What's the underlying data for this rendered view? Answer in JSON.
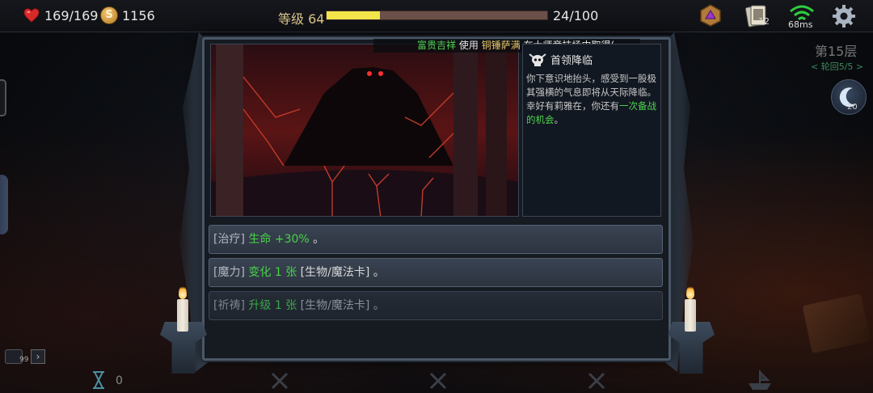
{
  "status": {
    "hp": "169/169",
    "gold": "1156",
    "gold_icon_letter": "S",
    "level_label": "等级 64",
    "xp_progress": 0.24,
    "xp_text": "24/100",
    "deck_count": "12",
    "ping": "68ms"
  },
  "floor": {
    "label": "第15层",
    "round": "< 轮回5/5 >",
    "moon_count": "20"
  },
  "marquee": {
    "player": "富贵吉祥",
    "verb": "使用",
    "hero": "铜锤萨满",
    "tail": "在大师竞技场中取得("
  },
  "event": {
    "title": "首领降临",
    "desc_1": "你下意识地抬头，感受到一股极其强横的气息即将从天际降临。",
    "desc_2_prefix": "幸好有莉雅在，你还有",
    "desc_2_highlight": "一次备战的机会",
    "desc_2_suffix": "。"
  },
  "options": [
    {
      "tag": "[治疗]",
      "effect": "生命 +30%",
      "rest": " 。"
    },
    {
      "tag": "[魔力]",
      "effect": "变化 1 张",
      "rest": " [生物/魔法卡] 。"
    },
    {
      "tag": "[祈祷]",
      "effect": "升级 1 张",
      "rest": " [生物/魔法卡] 。"
    }
  ],
  "bottom": {
    "chat_badge": "99",
    "expand_glyph": "›",
    "turns": "0"
  },
  "colors": {
    "accent_green": "#47d447",
    "xp_yellow": "#f2e54a",
    "gold_name": "#e8c76a",
    "frame": "#4a5766"
  },
  "icons": [
    "heart-icon",
    "coin-icon",
    "dice-icon",
    "card-deck-icon",
    "wifi-icon",
    "gear-icon",
    "moon-icon",
    "boss-skull-icon",
    "hourglass-icon",
    "close-x-icon",
    "ship-icon",
    "chat-icon"
  ]
}
